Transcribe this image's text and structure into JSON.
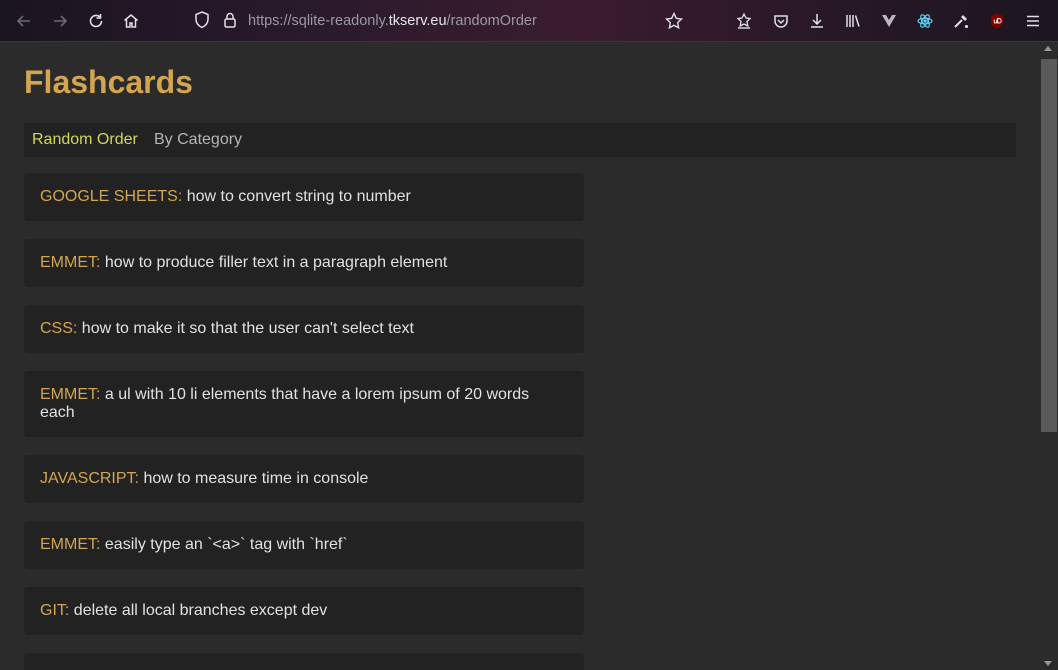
{
  "browser": {
    "url_prefix": "https://sqlite-readonly.",
    "url_domain": "tkserv.eu",
    "url_path": "/randomOrder"
  },
  "page": {
    "title": "Flashcards",
    "nav": [
      {
        "label": "Random Order",
        "active": true
      },
      {
        "label": "By Category",
        "active": false
      }
    ]
  },
  "cards": [
    {
      "category": "GOOGLE SHEETS:",
      "text": "how to convert string to number"
    },
    {
      "category": "EMMET:",
      "text": "how to produce filler text in a paragraph element"
    },
    {
      "category": "CSS:",
      "text": "how to make it so that the user can't select text"
    },
    {
      "category": "EMMET:",
      "text": "a ul with 10 li elements that have a lorem ipsum of 20 words each"
    },
    {
      "category": "JAVASCRIPT:",
      "text": "how to measure time in console"
    },
    {
      "category": "EMMET:",
      "text": "easily type an `<a>` tag with `href`"
    },
    {
      "category": "GIT:",
      "text": "delete all local branches except dev"
    }
  ],
  "colors": {
    "accent": "#d4a551",
    "nav_active": "#d2d65a",
    "card_bg": "#222222",
    "page_bg": "#2b2b2b"
  }
}
